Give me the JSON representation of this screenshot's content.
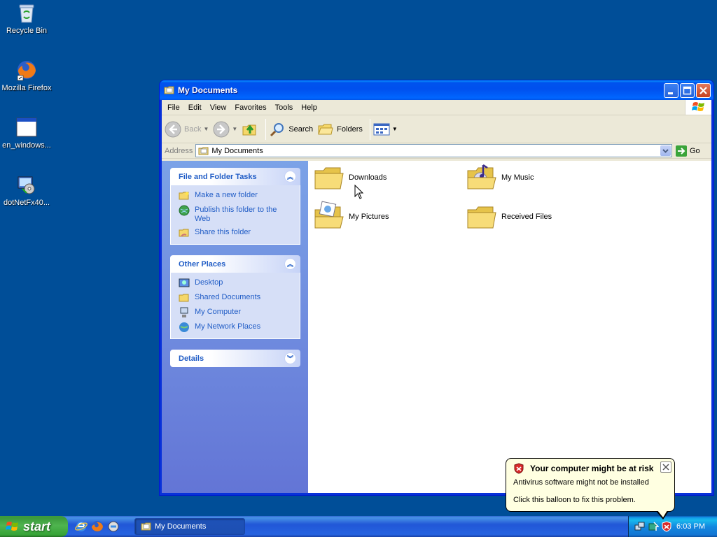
{
  "desktop": {
    "icons": [
      {
        "label": "Recycle Bin",
        "icon": "recycle-bin-icon"
      },
      {
        "label": "Mozilla Firefox",
        "icon": "firefox-icon"
      },
      {
        "label": "en_windows...",
        "icon": "window-app-icon"
      },
      {
        "label": "dotNetFx40...",
        "icon": "installer-icon"
      }
    ]
  },
  "window": {
    "title": "My Documents",
    "menu": [
      "File",
      "Edit",
      "View",
      "Favorites",
      "Tools",
      "Help"
    ],
    "toolbar": {
      "back": "Back",
      "search": "Search",
      "folders": "Folders"
    },
    "address": {
      "label": "Address",
      "value": "My Documents",
      "go": "Go"
    },
    "taskpane": {
      "file_folder_tasks": {
        "title": "File and Folder Tasks",
        "items": [
          "Make a new folder",
          "Publish this folder to the Web",
          "Share this folder"
        ]
      },
      "other_places": {
        "title": "Other Places",
        "items": [
          "Desktop",
          "Shared Documents",
          "My Computer",
          "My Network Places"
        ]
      },
      "details": {
        "title": "Details"
      }
    },
    "files": [
      "Downloads",
      "My Music",
      "My Pictures",
      "Received Files"
    ]
  },
  "taskbar": {
    "start": "start",
    "active_task": "My Documents",
    "clock": "6:03 PM"
  },
  "balloon": {
    "title": "Your computer might be at risk",
    "line1": "Antivirus software might not be installed",
    "line2": "Click this balloon to fix this problem."
  },
  "colors": {
    "desktop": "#004e98",
    "taskpane": "#6375d6",
    "link": "#215dc6",
    "balloon": "#ffffe1"
  }
}
